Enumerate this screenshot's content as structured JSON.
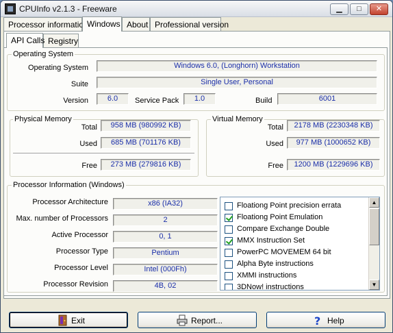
{
  "window": {
    "title": "CPUInfo v2.1.3 - Freeware",
    "controls": {
      "minimize": "▁",
      "maximize": "□",
      "close": "✕"
    }
  },
  "main_tabs": [
    "Processor information",
    "Windows",
    "About",
    "Professional version"
  ],
  "sub_tabs": [
    "API Calls",
    "Registry"
  ],
  "os": {
    "group_label": "Operating System",
    "os_label": "Operating System",
    "os_value": "Windows 6.0, (Longhorn) Workstation",
    "suite_label": "Suite",
    "suite_value": "Single User, Personal",
    "version_label": "Version",
    "version_value": "6.0",
    "sp_label": "Service Pack",
    "sp_value": "1.0",
    "build_label": "Build",
    "build_value": "6001"
  },
  "physical_memory": {
    "group_label": "Physical Memory",
    "total_label": "Total",
    "total_value": "958 MB (980992 KB)",
    "used_label": "Used",
    "used_value": "685 MB (701176 KB)",
    "free_label": "Free",
    "free_value": "273 MB (279816 KB)"
  },
  "virtual_memory": {
    "group_label": "Virtual Memory",
    "total_label": "Total",
    "total_value": "2178 MB (2230348 KB)",
    "used_label": "Used",
    "used_value": "977 MB (1000652 KB)",
    "free_label": "Free",
    "free_value": "1200 MB (1229696 KB)"
  },
  "processor": {
    "group_label": "Processor Information (Windows)",
    "arch_label": "Processor Architecture",
    "arch_value": "x86 (IA32)",
    "maxproc_label": "Max. number of Processors",
    "maxproc_value": "2",
    "active_label": "Active Processor",
    "active_value": "0, 1",
    "type_label": "Processor Type",
    "type_value": "Pentium",
    "level_label": "Processor Level",
    "level_value": "Intel (000Fh)",
    "rev_label": "Processor Revision",
    "rev_value": "4B, 02",
    "features": [
      {
        "label": "Floationg Point precision errata",
        "checked": false
      },
      {
        "label": "Floationg Point Emulation",
        "checked": true
      },
      {
        "label": "Compare Exchange Double",
        "checked": false
      },
      {
        "label": "MMX Instruction Set",
        "checked": true
      },
      {
        "label": "PowerPC MOVEMEM 64 bit",
        "checked": false
      },
      {
        "label": "Alpha Byte instructions",
        "checked": false
      },
      {
        "label": "XMMI instructions",
        "checked": false
      },
      {
        "label": "3DNow! instructions",
        "checked": false
      }
    ]
  },
  "buttons": {
    "exit": "Exit",
    "report": "Report...",
    "help": "Help"
  },
  "colors": {
    "value_text": "#1a2ea8",
    "panel": "#ece9d8"
  }
}
